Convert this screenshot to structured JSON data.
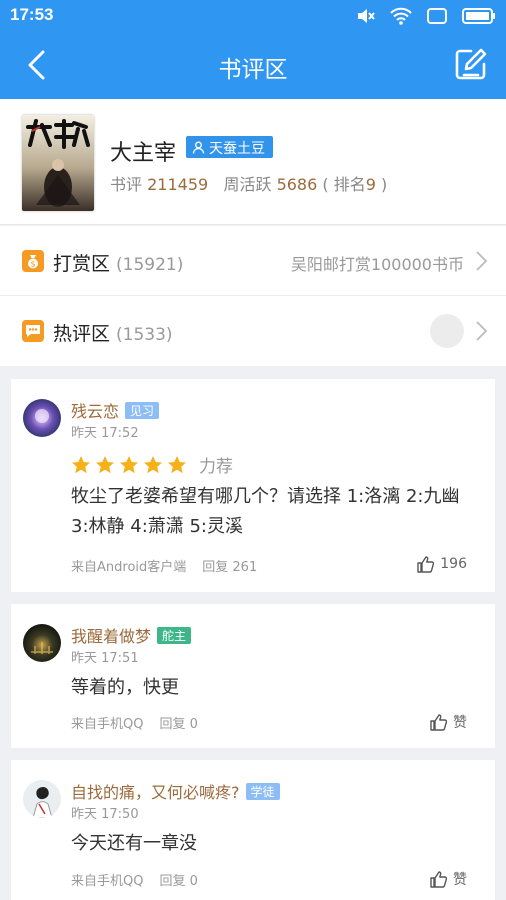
{
  "status_bar": {
    "time": "17:53"
  },
  "nav": {
    "title": "书评区"
  },
  "book": {
    "title": "大主宰",
    "author": "天蚕土豆",
    "review_label": "书评",
    "review_count": "211459",
    "active_label": "周活跃",
    "active_count": "5686",
    "rank_prefix": "( 排名",
    "rank": "9",
    "rank_suffix": " )"
  },
  "reward_row": {
    "title": "打赏区",
    "count": "(15921)",
    "latest": "吴阳邮打赏100000书币"
  },
  "hot_row": {
    "title": "热评区",
    "count": "(1533)"
  },
  "posts": [
    {
      "user": "残云恋",
      "tag": "见习",
      "time": "昨天 17:52",
      "rating": 5,
      "rating_label": "力荐",
      "text": "牧尘了老婆希望有哪几个？请选择 1:洛漓 2:九幽 3:林静 4:萧潇 5:灵溪",
      "source": "来自Android客户端",
      "reply": "回复 261",
      "likes": "196"
    },
    {
      "user": "我醒着做梦",
      "tag": "舵主",
      "time": "昨天 17:51",
      "text": "等着的，快更",
      "source": "来自手机QQ",
      "reply": "回复 0",
      "likes": "赞"
    },
    {
      "user": "自找的痛，又何必喊疼?",
      "tag": "学徒",
      "time": "昨天 17:50",
      "text": "今天还有一章没",
      "source": "来自手机QQ",
      "reply": "回复 0",
      "likes": "赞"
    }
  ],
  "colors": {
    "primary": "#2f96f2",
    "username": "#9c6b3d",
    "star": "#f5b01a",
    "badge_blue": "#3193ea"
  }
}
